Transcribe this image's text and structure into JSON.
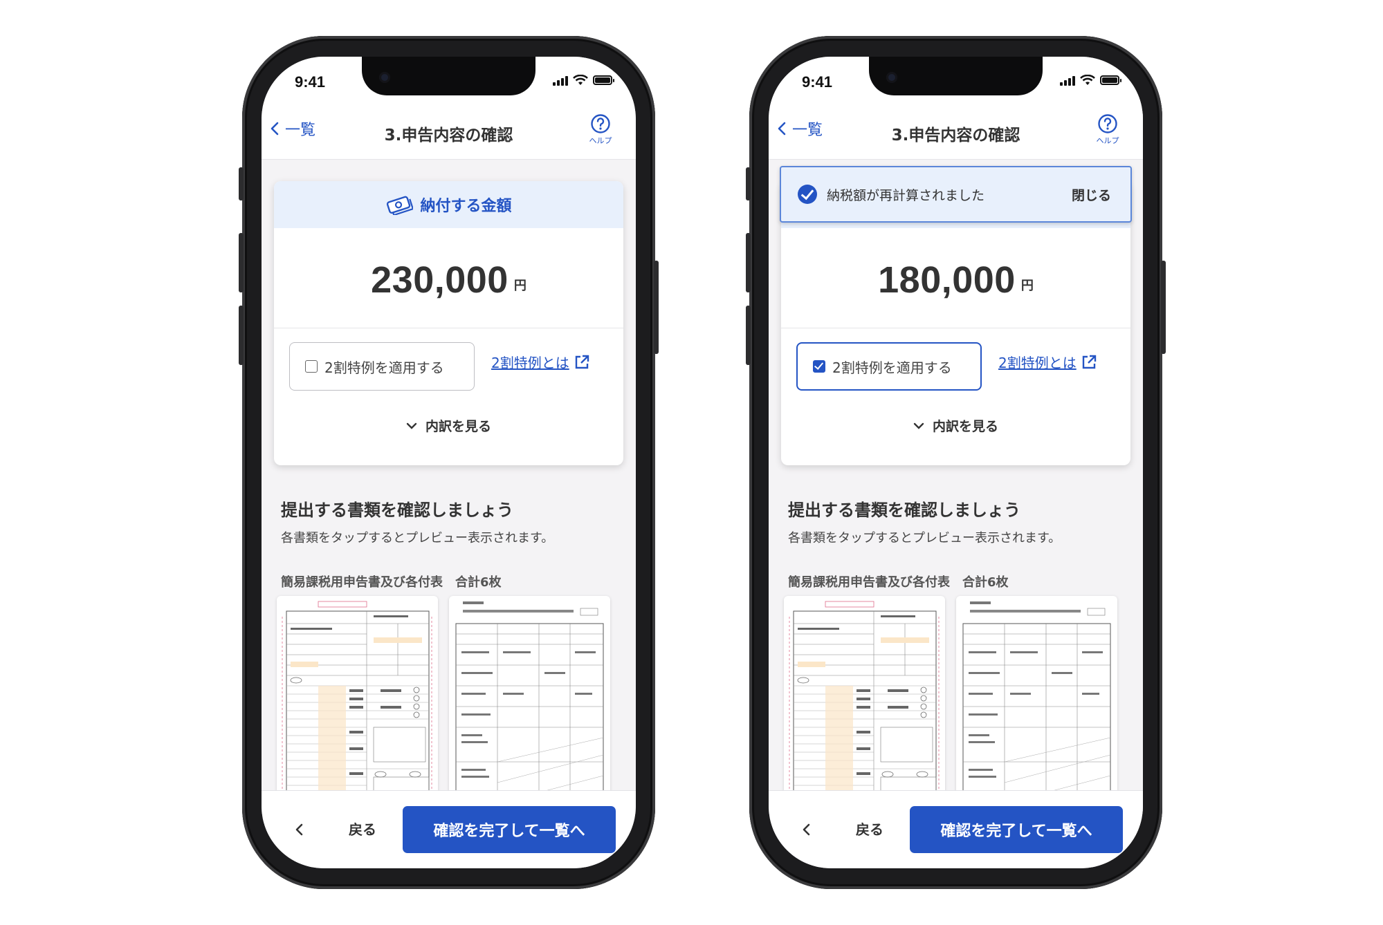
{
  "screens": [
    {
      "status_time": "9:41",
      "nav": {
        "back_label": "一覧",
        "title": "3.申告内容の確認",
        "help_label": "ヘルプ"
      },
      "card_header": "納付する金額",
      "amount": "230,000",
      "currency": "円",
      "special_rule_checkbox": {
        "label": "2割特例を適用する",
        "checked": false
      },
      "special_rule_link": "2割特例とは",
      "breakdown_label": "内訳を見る",
      "section_title": "提出する書類を確認しましょう",
      "section_desc": "各書類をタップするとプレビュー表示されます。",
      "documents_label": "簡易課税用申告書及び各付表　合計6枚",
      "footer": {
        "back_label": "戻る",
        "primary_label": "確認を完了して一覧へ"
      }
    },
    {
      "status_time": "9:41",
      "nav": {
        "back_label": "一覧",
        "title": "3.申告内容の確認",
        "help_label": "ヘルプ"
      },
      "toast": {
        "message": "納税額が再計算されました",
        "close_label": "閉じる"
      },
      "amount": "180,000",
      "currency": "円",
      "special_rule_checkbox": {
        "label": "2割特例を適用する",
        "checked": true
      },
      "special_rule_link": "2割特例とは",
      "breakdown_label": "内訳を見る",
      "section_title": "提出する書類を確認しましょう",
      "section_desc": "各書類をタップするとプレビュー表示されます。",
      "documents_label": "簡易課税用申告書及び各付表　合計6枚",
      "footer": {
        "back_label": "戻る",
        "primary_label": "確認を完了して一覧へ"
      }
    }
  ],
  "colors": {
    "accent": "#2454c4",
    "card_header_bg": "#e8f0fc",
    "screen_bg": "#f4f3f5"
  }
}
